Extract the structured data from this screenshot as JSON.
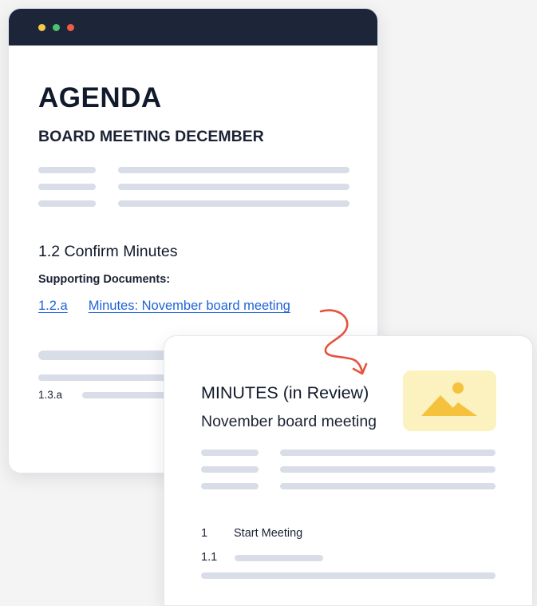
{
  "agenda": {
    "title": "AGENDA",
    "subtitle": "BOARD MEETING DECEMBER",
    "section_heading": "1.2  Confirm Minutes",
    "supporting_label": "Supporting Documents:",
    "link_number": "1.2.a",
    "link_text": "Minutes: November board meeting",
    "sub_item": "1.3.a"
  },
  "minutes": {
    "title": "MINUTES (in Review)",
    "subtitle": "November board meeting",
    "item_number": "1",
    "item_label": "Start Meeting",
    "sub_item": "1.1"
  },
  "colors": {
    "titlebar": "#1d2638",
    "link": "#1f63d8",
    "arrow": "#e5533d",
    "placeholder_bar": "#d8dde7",
    "image_bg": "#fbf2c0",
    "image_fg": "#f5c23d"
  },
  "icons": [
    "window-dot-yellow",
    "window-dot-green",
    "window-dot-red",
    "image-placeholder-icon",
    "curly-arrow-icon"
  ]
}
